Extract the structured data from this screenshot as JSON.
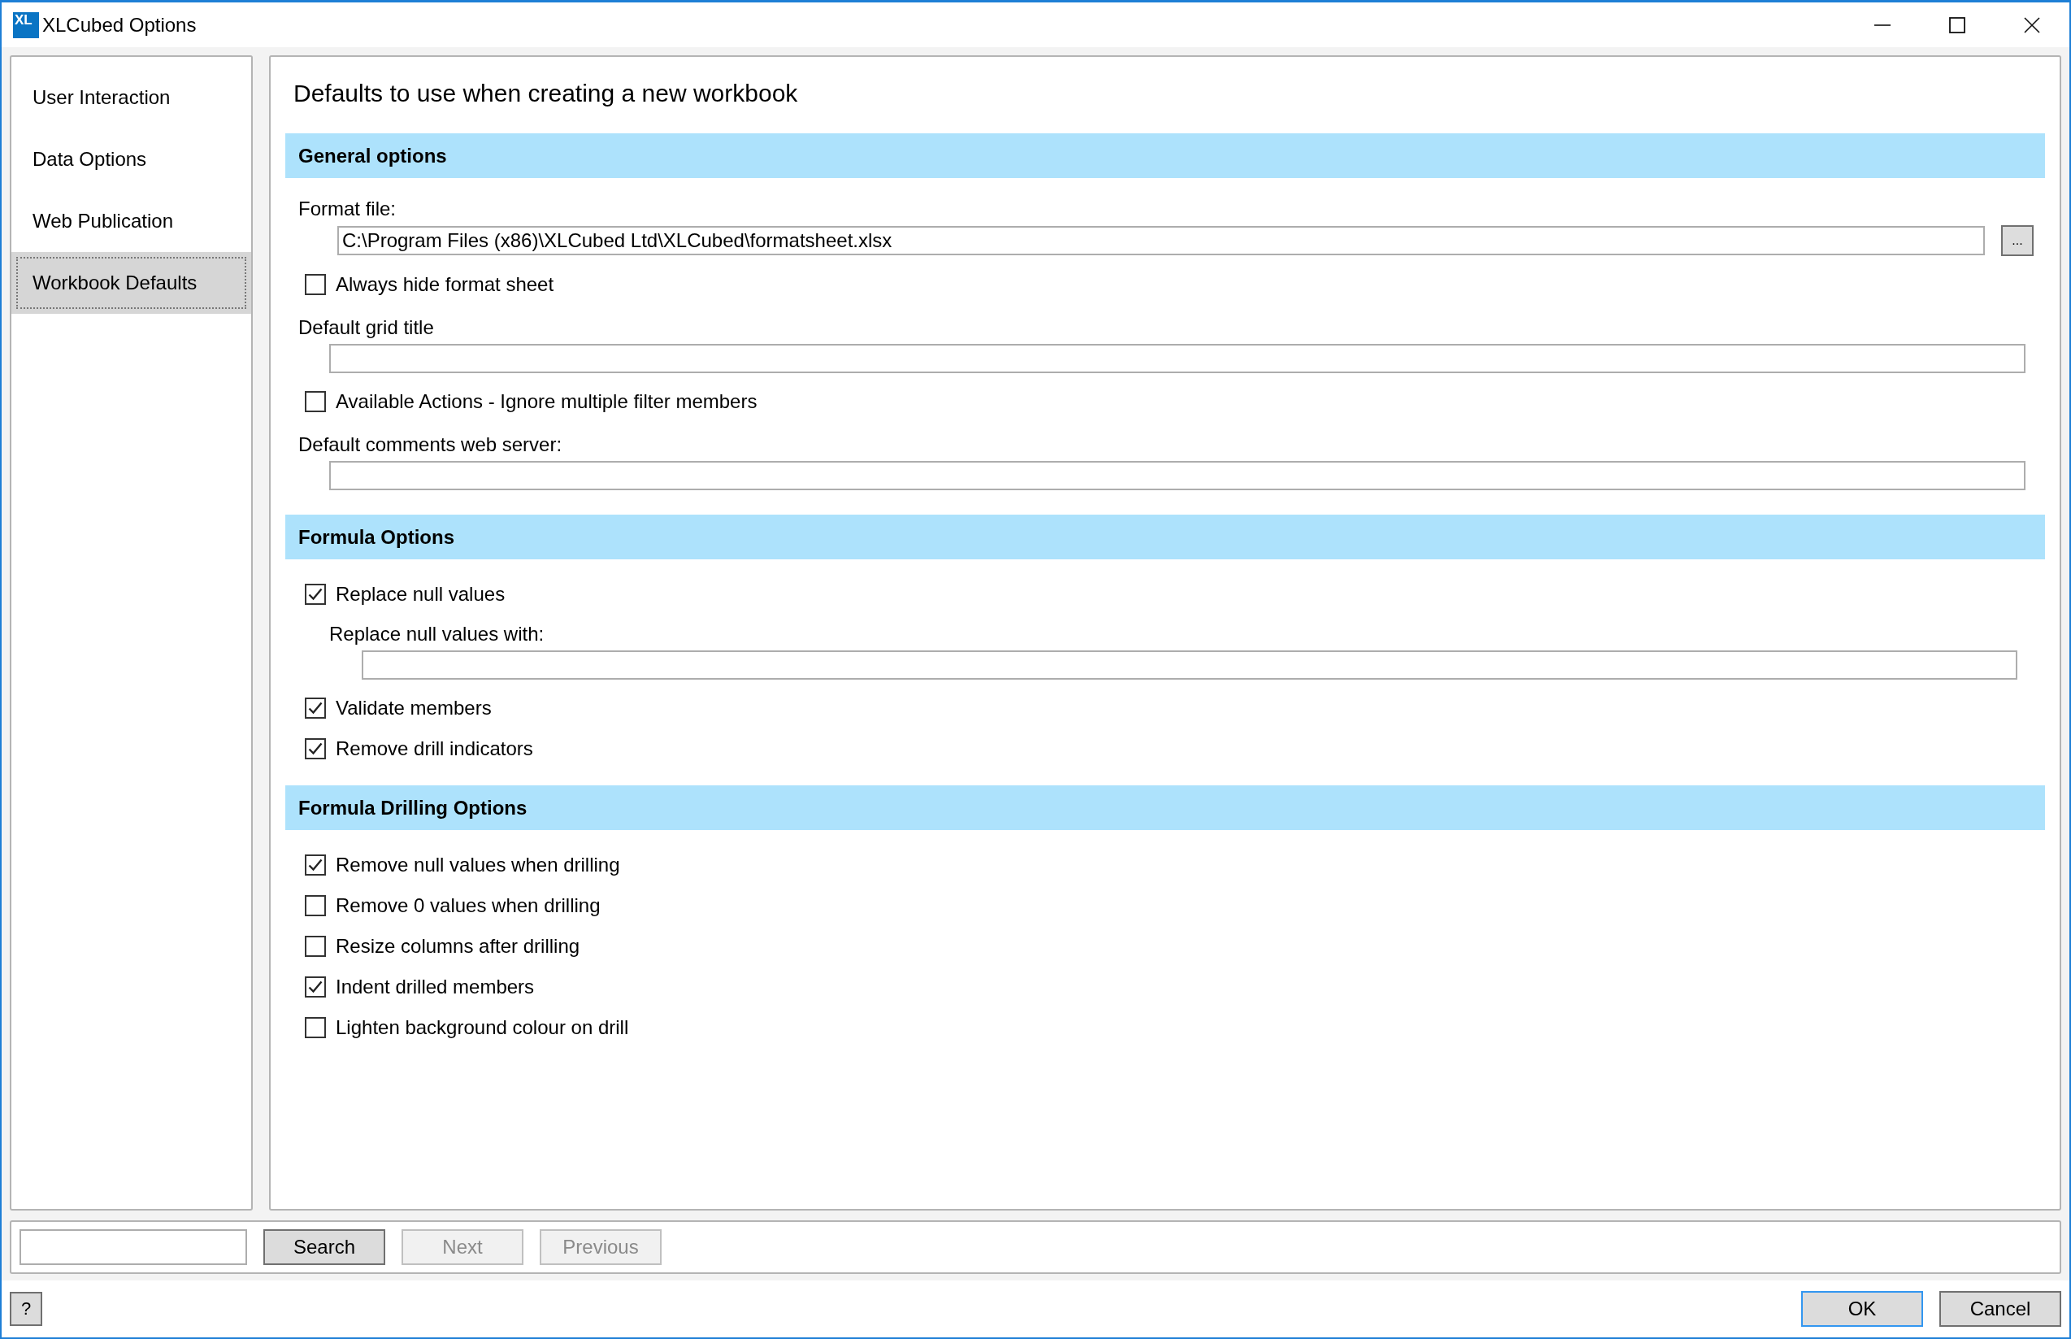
{
  "window": {
    "title": "XLCubed Options",
    "logo_text": "XL"
  },
  "sidebar": {
    "items": [
      {
        "label": "User Interaction",
        "selected": false
      },
      {
        "label": "Data Options",
        "selected": false
      },
      {
        "label": "Web Publication",
        "selected": false
      },
      {
        "label": "Workbook Defaults",
        "selected": true
      }
    ]
  },
  "content": {
    "heading": "Defaults to use when creating a new workbook",
    "sections": [
      {
        "title": "General options",
        "items": [
          {
            "kind": "label",
            "text": "Format file:"
          },
          {
            "kind": "file_field",
            "value": "C:\\Program Files (x86)\\XLCubed Ltd\\XLCubed\\formatsheet.xlsx",
            "button": "..."
          },
          {
            "kind": "checkbox",
            "label": "Always hide format sheet",
            "checked": false
          },
          {
            "kind": "label",
            "text": "Default grid title"
          },
          {
            "kind": "field"
          },
          {
            "kind": "checkbox",
            "label": "Available Actions - Ignore multiple filter members",
            "checked": false
          },
          {
            "kind": "label",
            "text": "Default comments web server:"
          },
          {
            "kind": "field"
          }
        ]
      },
      {
        "title": "Formula Options",
        "items": [
          {
            "kind": "checkbox",
            "label": "Replace null values",
            "checked": true
          },
          {
            "kind": "sublabel",
            "text": "Replace null values with:"
          },
          {
            "kind": "subfield"
          },
          {
            "kind": "checkbox",
            "label": "Validate members",
            "checked": true
          },
          {
            "kind": "checkbox",
            "label": "Remove drill indicators",
            "checked": true
          }
        ]
      },
      {
        "title": "Formula Drilling Options",
        "items": [
          {
            "kind": "checkbox",
            "label": "Remove null values when drilling",
            "checked": true
          },
          {
            "kind": "checkbox",
            "label": "Remove 0 values when drilling",
            "checked": false
          },
          {
            "kind": "checkbox",
            "label": "Resize columns after drilling",
            "checked": false
          },
          {
            "kind": "checkbox",
            "label": "Indent drilled members",
            "checked": true
          },
          {
            "kind": "checkbox",
            "label": "Lighten background colour on drill",
            "checked": false
          }
        ]
      }
    ]
  },
  "search_bar": {
    "buttons": [
      {
        "label": "Search",
        "disabled": false
      },
      {
        "label": "Next",
        "disabled": true
      },
      {
        "label": "Previous",
        "disabled": true
      }
    ]
  },
  "footer": {
    "help": "?",
    "buttons": [
      {
        "label": "OK",
        "default": true
      },
      {
        "label": "Cancel",
        "default": false
      }
    ]
  }
}
